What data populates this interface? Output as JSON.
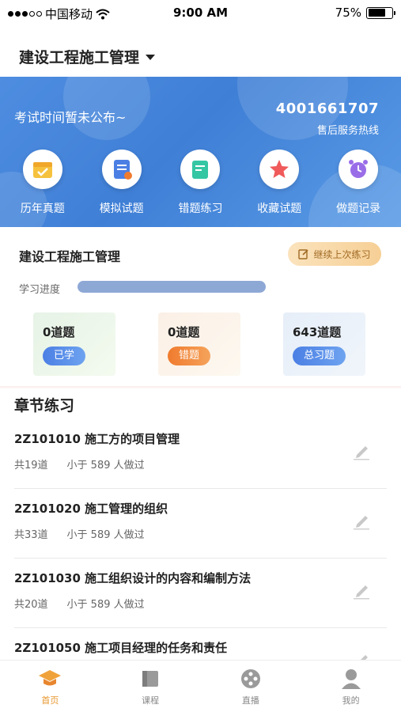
{
  "status_bar": {
    "carrier": "中国移动",
    "time": "9:00 AM",
    "battery": "75%"
  },
  "header": {
    "title": "建设工程施工管理"
  },
  "banner": {
    "exam_date": "考试时间暂未公布~",
    "hotline_number": "4001661707",
    "hotline_label": "售后服务热线",
    "quick_actions": [
      {
        "label": "历年真题",
        "icon": "calendar-check-icon"
      },
      {
        "label": "模拟试题",
        "icon": "exam-paper-icon"
      },
      {
        "label": "错题练习",
        "icon": "notebook-icon"
      },
      {
        "label": "收藏试题",
        "icon": "star-icon"
      },
      {
        "label": "做题记录",
        "icon": "alarm-clock-icon"
      }
    ]
  },
  "course": {
    "name": "建设工程施工管理",
    "continue_label": "继续上次练习",
    "progress_label": "学习进度",
    "stats": [
      {
        "count": "0道题",
        "label": "已学"
      },
      {
        "count": "0道题",
        "label": "错题"
      },
      {
        "count": "643道题",
        "label": "总习题"
      }
    ]
  },
  "chapters_section": {
    "title": "章节练习",
    "items": [
      {
        "title": "2Z101010 施工方的项目管理",
        "count": "共19道",
        "done_by": "小于 589 人做过"
      },
      {
        "title": "2Z101020 施工管理的组织",
        "count": "共33道",
        "done_by": "小于 589 人做过"
      },
      {
        "title": "2Z101030 施工组织设计的内容和编制方法",
        "count": "共20道",
        "done_by": "小于 589 人做过"
      },
      {
        "title": "2Z101050 施工项目经理的任务和责任",
        "count": "",
        "done_by": ""
      }
    ]
  },
  "tabbar": {
    "tabs": [
      {
        "label": "首页",
        "icon": "graduation-cap-icon",
        "active": true
      },
      {
        "label": "课程",
        "icon": "book-icon",
        "active": false
      },
      {
        "label": "直播",
        "icon": "film-reel-icon",
        "active": false
      },
      {
        "label": "我的",
        "icon": "user-icon",
        "active": false
      }
    ]
  },
  "colors": {
    "accent": "#e8962e",
    "banner": "#4a87dc",
    "progress": "#8ea8d6"
  }
}
